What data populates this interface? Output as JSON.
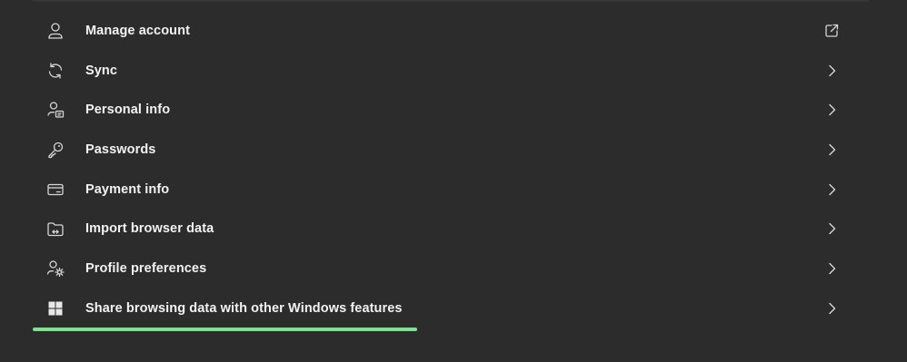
{
  "settings": {
    "items": [
      {
        "label": "Manage account",
        "icon": "person-icon",
        "action": "external-link-icon"
      },
      {
        "label": "Sync",
        "icon": "sync-icon",
        "action": "chevron-right-icon"
      },
      {
        "label": "Personal info",
        "icon": "person-card-icon",
        "action": "chevron-right-icon"
      },
      {
        "label": "Passwords",
        "icon": "key-icon",
        "action": "chevron-right-icon"
      },
      {
        "label": "Payment info",
        "icon": "credit-card-icon",
        "action": "chevron-right-icon"
      },
      {
        "label": "Import browser data",
        "icon": "folder-import-icon",
        "action": "chevron-right-icon"
      },
      {
        "label": "Profile preferences",
        "icon": "person-settings-icon",
        "action": "chevron-right-icon"
      },
      {
        "label": "Share browsing data with other Windows features",
        "icon": "windows-logo-icon",
        "action": "chevron-right-icon"
      }
    ]
  },
  "colors": {
    "background": "#2c2c2c",
    "text": "#f2f2f2",
    "icon": "#d6d6d6",
    "highlight": "#7ee28f"
  }
}
